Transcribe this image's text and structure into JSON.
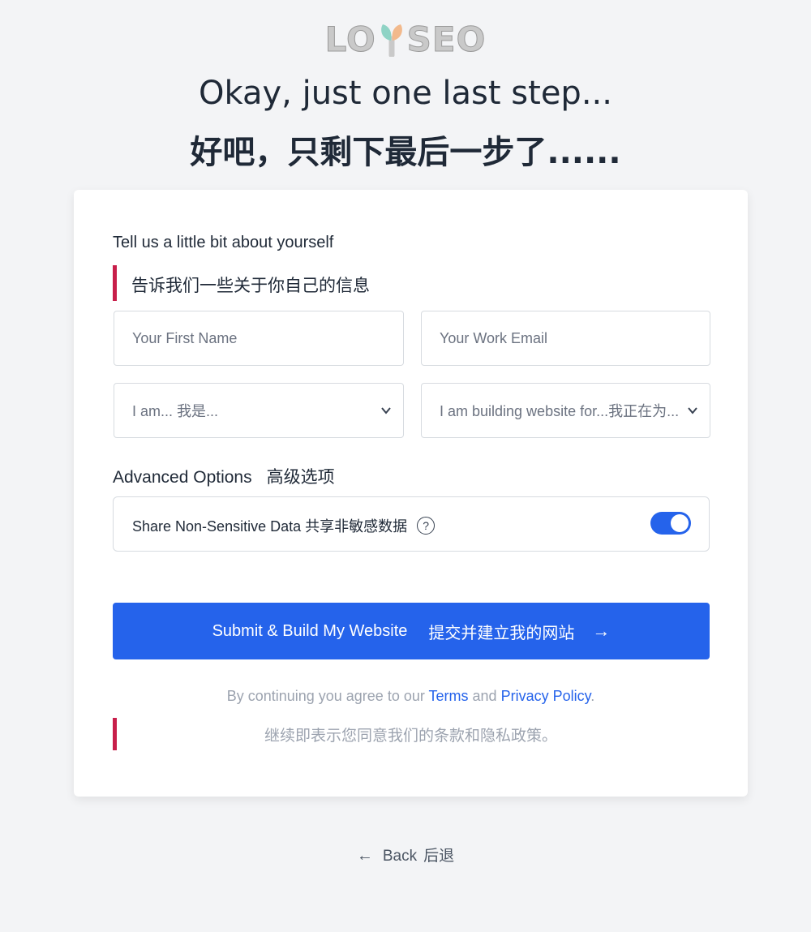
{
  "logo": {
    "text_left": "LO",
    "text_right": "SEO"
  },
  "header": {
    "title_en": "Okay, just one last step...",
    "title_zh": "好吧，只剩下最后一步了......"
  },
  "form": {
    "section_label": "Tell us a little bit about yourself",
    "section_label_zh": "告诉我们一些关于你自己的信息",
    "first_name_placeholder": "Your First Name",
    "email_placeholder": "Your Work Email",
    "role_select": "I am... 我是...",
    "purpose_select": "I am building website for...我正在为...",
    "advanced_label": "Advanced Options",
    "advanced_label_zh": "高级选项",
    "share_data_label": "Share Non-Sensitive Data 共享非敏感数据",
    "share_data_enabled": true,
    "help_icon": "?",
    "submit_label": "Submit & Build My Website",
    "submit_label_zh": "提交并建立我的网站",
    "submit_arrow": "→",
    "terms_prefix": "By continuing you agree to our ",
    "terms_link": "Terms",
    "terms_and": " and ",
    "privacy_link": "Privacy Policy",
    "terms_suffix": ".",
    "terms_zh": "继续即表示您同意我们的条款和隐私政策。"
  },
  "footer": {
    "back_arrow": "←",
    "back_label": "Back",
    "back_label_zh": "后退"
  },
  "colors": {
    "accent": "#2563eb",
    "bar": "#c81e4a",
    "background": "#f3f4f6"
  }
}
